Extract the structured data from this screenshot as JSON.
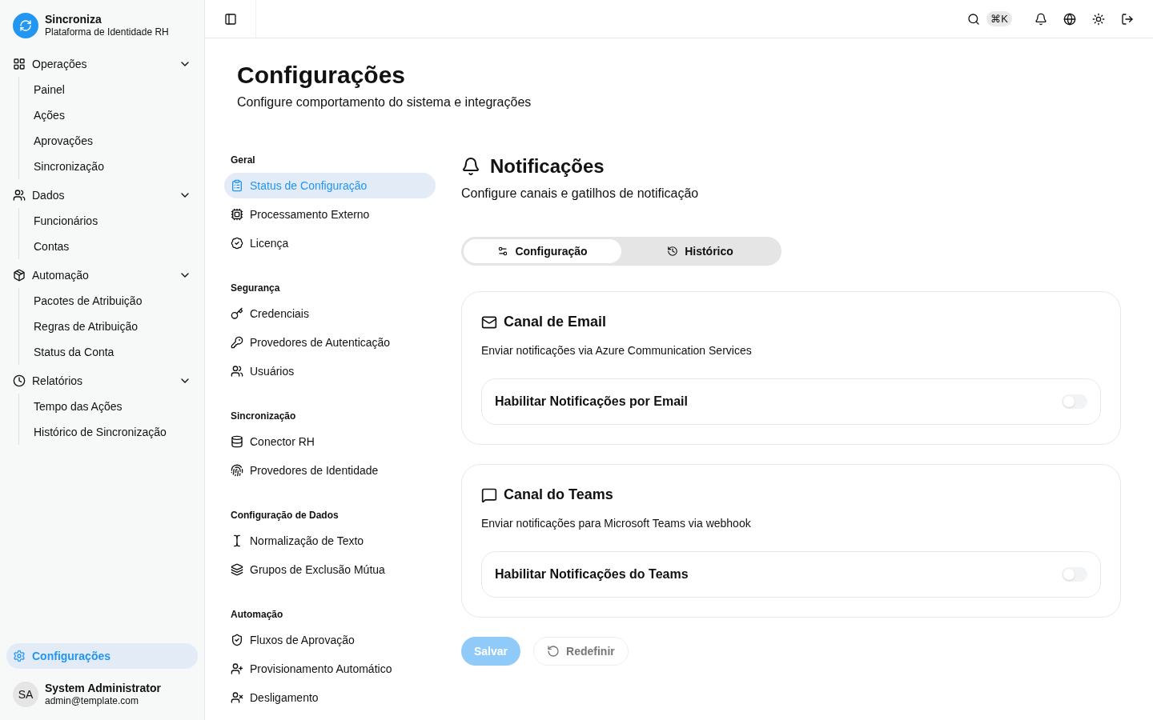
{
  "brand": {
    "name": "Sincroniza",
    "subtitle": "Plataforma de Identidade RH"
  },
  "sidebar": {
    "groups": [
      {
        "label": "Operações",
        "expanded": true,
        "children": [
          {
            "label": "Painel"
          },
          {
            "label": "Ações"
          },
          {
            "label": "Aprovações"
          },
          {
            "label": "Sincronização"
          }
        ]
      },
      {
        "label": "Dados",
        "expanded": true,
        "children": [
          {
            "label": "Funcionários"
          },
          {
            "label": "Contas"
          }
        ]
      },
      {
        "label": "Automação",
        "expanded": true,
        "children": [
          {
            "label": "Pacotes de Atribuição"
          },
          {
            "label": "Regras de Atribuição"
          },
          {
            "label": "Status da Conta"
          }
        ]
      },
      {
        "label": "Relatórios",
        "expanded": true,
        "children": [
          {
            "label": "Tempo das Ações"
          },
          {
            "label": "Histórico de Sincronização"
          }
        ]
      }
    ],
    "settings_item": {
      "label": "Configurações",
      "selected": true
    },
    "user": {
      "initials": "SA",
      "name": "System Administrator",
      "email": "admin@template.com"
    }
  },
  "topbar": {
    "shortcut": "⌘K"
  },
  "page": {
    "title": "Configurações",
    "subtitle": "Configure comportamento do sistema e integrações"
  },
  "settings_nav": [
    {
      "heading": "Geral",
      "items": [
        {
          "label": "Status de Configuração",
          "selected": true
        },
        {
          "label": "Processamento Externo",
          "selected": false
        },
        {
          "label": "Licença",
          "selected": false
        }
      ]
    },
    {
      "heading": "Segurança",
      "items": [
        {
          "label": "Credenciais",
          "selected": false
        },
        {
          "label": "Provedores de Autenticação",
          "selected": false
        },
        {
          "label": "Usuários",
          "selected": false
        }
      ]
    },
    {
      "heading": "Sincronização",
      "items": [
        {
          "label": "Conector RH",
          "selected": false
        },
        {
          "label": "Provedores de Identidade",
          "selected": false
        }
      ]
    },
    {
      "heading": "Configuração de Dados",
      "items": [
        {
          "label": "Normalização de Texto",
          "selected": false
        },
        {
          "label": "Grupos de Exclusão Mútua",
          "selected": false
        }
      ]
    },
    {
      "heading": "Automação",
      "items": [
        {
          "label": "Fluxos de Aprovação",
          "selected": false
        },
        {
          "label": "Provisionamento Automático",
          "selected": false
        },
        {
          "label": "Desligamento",
          "selected": false
        }
      ]
    }
  ],
  "section": {
    "title": "Notificações",
    "subtitle": "Configure canais e gatilhos de notificação",
    "tabs": [
      {
        "label": "Configuração",
        "selected": true
      },
      {
        "label": "Histórico",
        "selected": false
      }
    ],
    "channels": [
      {
        "title": "Canal de Email",
        "description": "Enviar notificações via Azure Communication Services",
        "toggle_label": "Habilitar Notificações por Email",
        "on": false
      },
      {
        "title": "Canal do Teams",
        "description": "Enviar notificações para Microsoft Teams via webhook",
        "toggle_label": "Habilitar Notificações do Teams",
        "on": false
      }
    ],
    "buttons": [
      {
        "label": "Salvar",
        "kind": "primary",
        "disabled": true
      },
      {
        "label": "Redefinir",
        "kind": "secondary",
        "disabled": true
      }
    ]
  }
}
